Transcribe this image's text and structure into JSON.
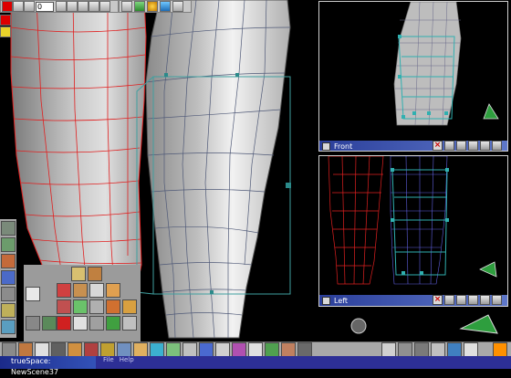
{
  "app": {
    "frame_field_value": "0",
    "status_title": "trueSpace: NewScene37",
    "menu": [
      "File",
      "Help"
    ]
  },
  "viewports": {
    "front": {
      "label": "Front"
    },
    "left": {
      "label": "Left"
    }
  },
  "colors": {
    "wire_red": "#e02020",
    "wire_blue": "#6060e0",
    "wire_cyan": "#40a0a0",
    "titlebar": "#2a3e9a"
  },
  "icons": {
    "top_toolbar": [
      "play-first-icon",
      "stop-icon",
      "prev-frame-icon",
      "frame-field",
      "keyframe-icon",
      "next-frame-icon",
      "last-frame-icon",
      "grid-icon",
      "object-tool-icon",
      "ball-icon",
      "render-icon",
      "teapot-icon"
    ],
    "bottom_toolbar": [
      "sphere-icon",
      "cube-icon",
      "cylinder-icon",
      "torus-icon",
      "material-icon",
      "light-icon",
      "camera-icon",
      "texture-icon",
      "render-icon",
      "face-icon",
      "script-icon",
      "eye-icon"
    ],
    "viewport_tools": [
      "eye-nav-icon",
      "move-icon",
      "zoom-icon",
      "rotate-icon",
      "pan-icon"
    ]
  }
}
